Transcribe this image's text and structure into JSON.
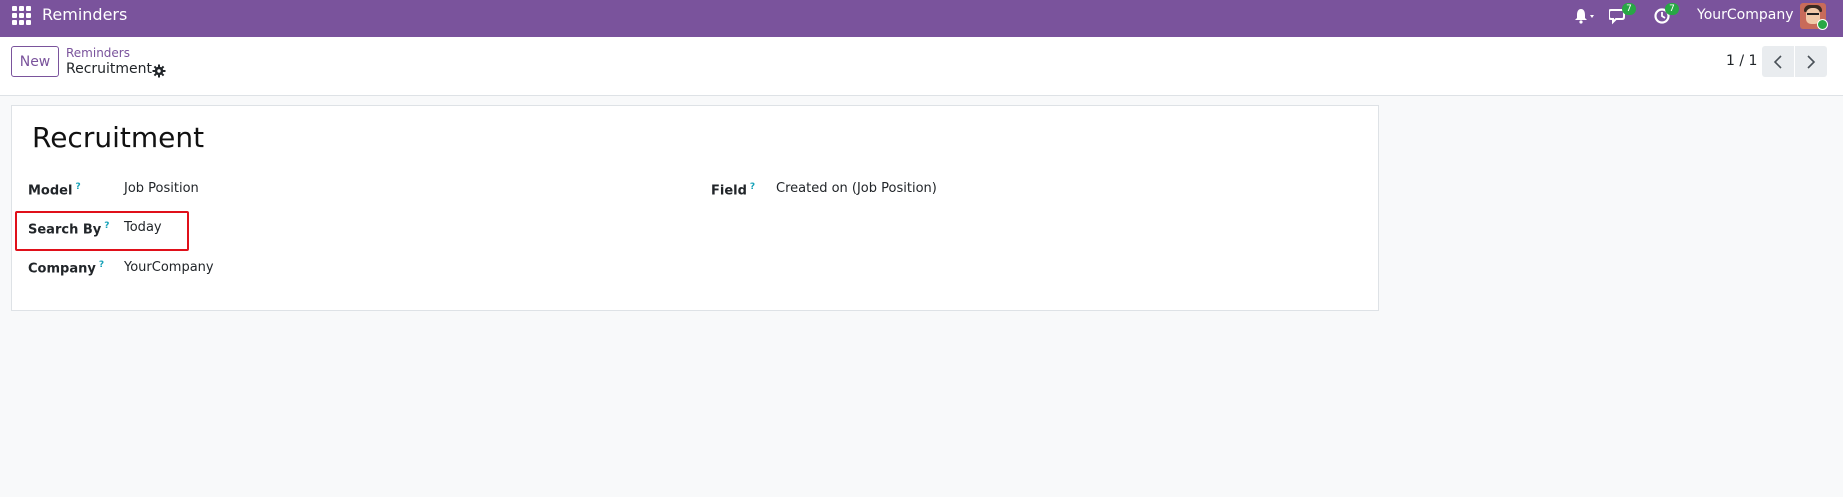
{
  "navbar": {
    "app_title": "Reminders",
    "messages_count": "7",
    "activities_count": "7",
    "company": "YourCompany",
    "bg_color": "#7a539c",
    "icons": [
      "apps-grid-icon",
      "bell-icon",
      "chat-icon",
      "clock-icon",
      "avatar"
    ]
  },
  "control_panel": {
    "new_label": "New",
    "breadcrumb_parent": "Reminders",
    "breadcrumb_current": "Recruitment",
    "pager": "1 / 1"
  },
  "form": {
    "title": "Recruitment",
    "help_marker": "?",
    "fields": {
      "model": {
        "label": "Model",
        "value": "Job Position"
      },
      "search_by": {
        "label": "Search By",
        "value": "Today"
      },
      "company": {
        "label": "Company",
        "value": "YourCompany"
      },
      "field": {
        "label": "Field",
        "value": "Created on (Job Position)"
      }
    }
  },
  "colors": {
    "accent": "#7a539c",
    "highlight": "#e0101a",
    "badge": "#28a745",
    "help": "#17a2b8"
  }
}
